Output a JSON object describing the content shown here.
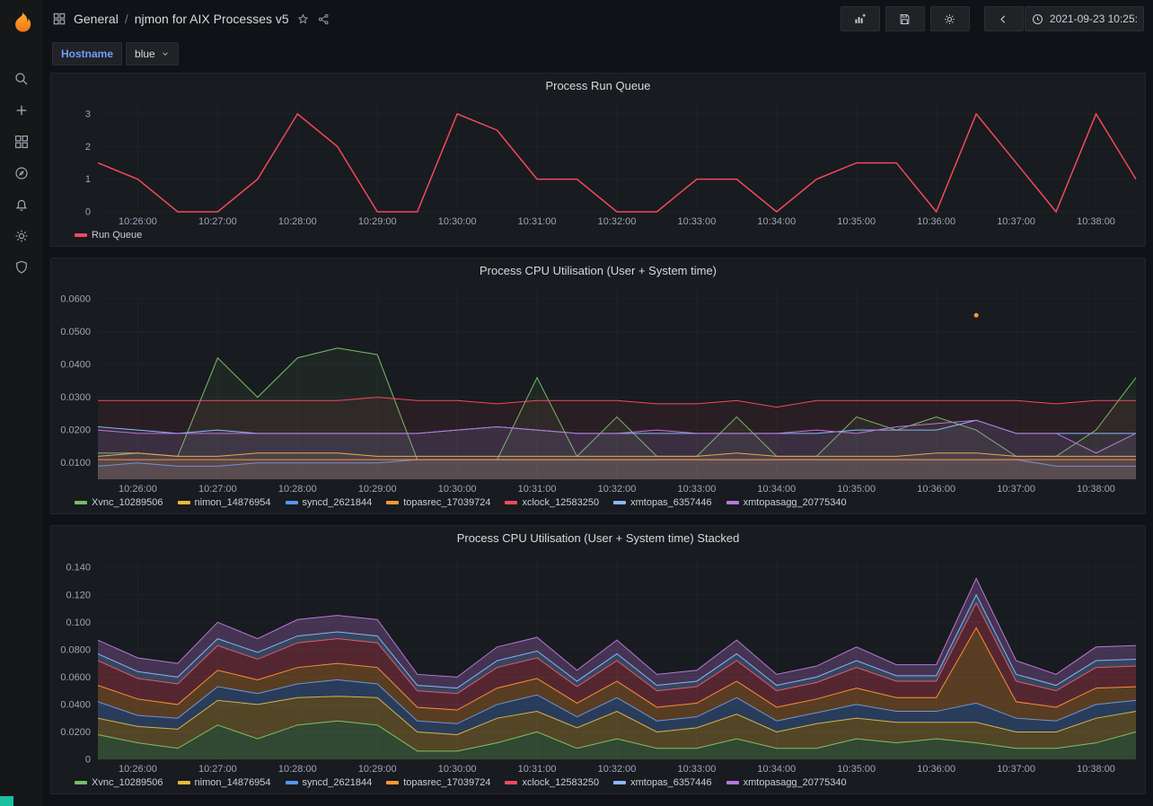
{
  "app": {
    "name": "Grafana"
  },
  "sidebar": {
    "items": [
      "search",
      "create",
      "dashboards",
      "explore",
      "alerting",
      "configuration",
      "server-admin"
    ]
  },
  "navbar": {
    "breadcrumb": {
      "section": "General",
      "separator": "/",
      "title": "njmon for AIX Processes v5"
    },
    "time_range": "2021-09-23 10:25:"
  },
  "variables": {
    "hostname_label": "Hostname",
    "hostname_value": "blue"
  },
  "colors": {
    "green": "#73BF69",
    "yellow": "#EAB839",
    "blue": "#5794F2",
    "orange": "#FF9830",
    "red": "#F2495C",
    "light_blue": "#8AB8FF",
    "purple": "#B877D9",
    "accent_blue": "#6e9fff"
  },
  "chart_data": [
    {
      "type": "line",
      "title": "Process Run Queue",
      "stacked": false,
      "fill_opacity": 0,
      "line_width": 1.5,
      "ylim": [
        0,
        3.3
      ],
      "y_ticks": {
        "values": [
          0,
          1,
          2,
          3
        ],
        "labels": [
          "0",
          "1",
          "2",
          "3"
        ]
      },
      "x": [
        "10:25:30",
        "10:26:00",
        "10:26:30",
        "10:27:00",
        "10:27:30",
        "10:28:00",
        "10:28:30",
        "10:29:00",
        "10:29:30",
        "10:30:00",
        "10:30:30",
        "10:31:00",
        "10:31:30",
        "10:32:00",
        "10:32:30",
        "10:33:00",
        "10:33:30",
        "10:34:00",
        "10:34:30",
        "10:35:00",
        "10:35:30",
        "10:36:00",
        "10:36:30",
        "10:37:00",
        "10:37:30",
        "10:38:00",
        "10:38:30"
      ],
      "x_ticks": [
        "10:26:00",
        "10:27:00",
        "10:28:00",
        "10:29:00",
        "10:30:00",
        "10:31:00",
        "10:32:00",
        "10:33:00",
        "10:34:00",
        "10:35:00",
        "10:36:00",
        "10:37:00",
        "10:38:00"
      ],
      "series": [
        {
          "name": "Run Queue",
          "color": "#F2495C",
          "values": [
            1.5,
            1,
            0,
            0,
            1,
            3,
            2,
            0,
            0,
            3,
            2.5,
            1,
            1,
            0,
            0,
            1,
            1,
            0,
            1,
            1.5,
            1.5,
            0,
            3,
            1.5,
            0,
            3,
            1
          ]
        }
      ]
    },
    {
      "type": "line",
      "title": "Process CPU Utilisation (User + System time)",
      "stacked": false,
      "fill_opacity": 0.08,
      "line_width": 1,
      "ylim": [
        0.005,
        0.063
      ],
      "y_ticks": {
        "values": [
          0.01,
          0.02,
          0.03,
          0.04,
          0.05,
          0.06
        ],
        "labels": [
          "0.0100",
          "0.0200",
          "0.0300",
          "0.0400",
          "0.0500",
          "0.0600"
        ]
      },
      "x": [
        "10:25:30",
        "10:26:00",
        "10:26:30",
        "10:27:00",
        "10:27:30",
        "10:28:00",
        "10:28:30",
        "10:29:00",
        "10:29:30",
        "10:30:00",
        "10:30:30",
        "10:31:00",
        "10:31:30",
        "10:32:00",
        "10:32:30",
        "10:33:00",
        "10:33:30",
        "10:34:00",
        "10:34:30",
        "10:35:00",
        "10:35:30",
        "10:36:00",
        "10:36:30",
        "10:37:00",
        "10:37:30",
        "10:38:00",
        "10:38:30"
      ],
      "x_ticks": [
        "10:26:00",
        "10:27:00",
        "10:28:00",
        "10:29:00",
        "10:30:00",
        "10:31:00",
        "10:32:00",
        "10:33:00",
        "10:34:00",
        "10:35:00",
        "10:36:00",
        "10:37:00",
        "10:38:00"
      ],
      "point_markers": [
        {
          "x": "10:36:30",
          "value": 0.055,
          "color": "#FF9830",
          "series": "topasrec_17039724"
        }
      ],
      "series": [
        {
          "name": "Xvnc_10289506",
          "color": "#73BF69",
          "values": [
            0.013,
            0.013,
            0.012,
            0.042,
            0.03,
            0.042,
            0.045,
            0.043,
            0.011,
            0.011,
            0.011,
            0.036,
            0.012,
            0.024,
            0.012,
            0.012,
            0.024,
            0.012,
            0.012,
            0.024,
            0.02,
            0.024,
            0.02,
            0.012,
            0.012,
            0.02,
            0.036
          ]
        },
        {
          "name": "nimon_14876954",
          "color": "#EAB839",
          "values": [
            0.012,
            0.013,
            0.012,
            0.012,
            0.013,
            0.013,
            0.013,
            0.012,
            0.012,
            0.012,
            0.012,
            0.012,
            0.012,
            0.012,
            0.012,
            0.012,
            0.013,
            0.012,
            0.012,
            0.012,
            0.012,
            0.013,
            0.013,
            0.012,
            0.012,
            0.012,
            0.012
          ]
        },
        {
          "name": "syncd_2621844",
          "color": "#5794F2",
          "values": [
            0.009,
            0.01,
            0.009,
            0.009,
            0.01,
            0.01,
            0.01,
            0.01,
            0.011,
            0.011,
            0.011,
            0.011,
            0.011,
            0.011,
            0.011,
            0.011,
            0.011,
            0.011,
            0.011,
            0.011,
            0.011,
            0.011,
            0.011,
            0.011,
            0.009,
            0.009,
            0.009
          ]
        },
        {
          "name": "topasrec_17039724",
          "color": "#FF9830",
          "values": [
            0.011,
            0.011,
            0.011,
            0.011,
            0.011,
            0.011,
            0.011,
            0.011,
            0.011,
            0.011,
            0.011,
            0.011,
            0.011,
            0.011,
            0.011,
            0.011,
            0.011,
            0.011,
            0.011,
            0.011,
            0.011,
            0.011,
            0.011,
            0.011,
            0.011,
            0.011,
            0.011
          ]
        },
        {
          "name": "xclock_12583250",
          "color": "#F2495C",
          "values": [
            0.029,
            0.029,
            0.029,
            0.029,
            0.029,
            0.029,
            0.029,
            0.03,
            0.029,
            0.029,
            0.028,
            0.029,
            0.029,
            0.029,
            0.028,
            0.028,
            0.029,
            0.027,
            0.029,
            0.029,
            0.029,
            0.029,
            0.029,
            0.029,
            0.028,
            0.029,
            0.029
          ]
        },
        {
          "name": "xmtopas_6357446",
          "color": "#8AB8FF",
          "values": [
            0.021,
            0.02,
            0.019,
            0.02,
            0.019,
            0.019,
            0.019,
            0.019,
            0.019,
            0.02,
            0.021,
            0.02,
            0.019,
            0.019,
            0.019,
            0.019,
            0.019,
            0.019,
            0.019,
            0.02,
            0.02,
            0.02,
            0.023,
            0.019,
            0.019,
            0.019,
            0.019
          ]
        },
        {
          "name": "xmtopasagg_20775340",
          "color": "#B877D9",
          "values": [
            0.02,
            0.019,
            0.019,
            0.019,
            0.019,
            0.019,
            0.019,
            0.019,
            0.019,
            0.02,
            0.021,
            0.02,
            0.019,
            0.019,
            0.02,
            0.019,
            0.019,
            0.019,
            0.02,
            0.019,
            0.021,
            0.022,
            0.023,
            0.019,
            0.019,
            0.013,
            0.019
          ]
        }
      ]
    },
    {
      "type": "area",
      "title": "Process CPU Utilisation (User + System time) Stacked",
      "stacked": true,
      "fill_opacity": 0.28,
      "line_width": 1,
      "ylim": [
        0,
        0.148
      ],
      "y_ticks": {
        "values": [
          0,
          0.02,
          0.04,
          0.06,
          0.08,
          0.1,
          0.12,
          0.14
        ],
        "labels": [
          "0",
          "0.0200",
          "0.0400",
          "0.0600",
          "0.0800",
          "0.100",
          "0.120",
          "0.140"
        ]
      },
      "x": [
        "10:25:30",
        "10:26:00",
        "10:26:30",
        "10:27:00",
        "10:27:30",
        "10:28:00",
        "10:28:30",
        "10:29:00",
        "10:29:30",
        "10:30:00",
        "10:30:30",
        "10:31:00",
        "10:31:30",
        "10:32:00",
        "10:32:30",
        "10:33:00",
        "10:33:30",
        "10:34:00",
        "10:34:30",
        "10:35:00",
        "10:35:30",
        "10:36:00",
        "10:36:30",
        "10:37:00",
        "10:37:30",
        "10:38:00",
        "10:38:30"
      ],
      "x_ticks": [
        "10:26:00",
        "10:27:00",
        "10:28:00",
        "10:29:00",
        "10:30:00",
        "10:31:00",
        "10:32:00",
        "10:33:00",
        "10:34:00",
        "10:35:00",
        "10:36:00",
        "10:37:00",
        "10:38:00"
      ],
      "series": [
        {
          "name": "Xvnc_10289506",
          "color": "#73BF69",
          "values": [
            0.018,
            0.012,
            0.008,
            0.025,
            0.015,
            0.025,
            0.028,
            0.025,
            0.006,
            0.006,
            0.012,
            0.02,
            0.008,
            0.015,
            0.008,
            0.008,
            0.015,
            0.008,
            0.008,
            0.015,
            0.012,
            0.015,
            0.012,
            0.008,
            0.008,
            0.012,
            0.02
          ]
        },
        {
          "name": "nimon_14876954",
          "color": "#EAB839",
          "values": [
            0.012,
            0.012,
            0.014,
            0.018,
            0.025,
            0.02,
            0.018,
            0.02,
            0.014,
            0.012,
            0.018,
            0.015,
            0.015,
            0.02,
            0.012,
            0.015,
            0.018,
            0.012,
            0.018,
            0.015,
            0.015,
            0.012,
            0.015,
            0.012,
            0.012,
            0.018,
            0.015
          ]
        },
        {
          "name": "syncd_2621844",
          "color": "#5794F2",
          "values": [
            0.012,
            0.008,
            0.008,
            0.01,
            0.008,
            0.01,
            0.012,
            0.01,
            0.008,
            0.008,
            0.01,
            0.012,
            0.008,
            0.01,
            0.008,
            0.008,
            0.012,
            0.008,
            0.008,
            0.01,
            0.008,
            0.008,
            0.014,
            0.01,
            0.008,
            0.01,
            0.008
          ]
        },
        {
          "name": "topasrec_17039724",
          "color": "#FF9830",
          "values": [
            0.012,
            0.012,
            0.01,
            0.012,
            0.01,
            0.012,
            0.012,
            0.012,
            0.01,
            0.01,
            0.012,
            0.012,
            0.01,
            0.012,
            0.01,
            0.01,
            0.012,
            0.01,
            0.01,
            0.012,
            0.01,
            0.01,
            0.055,
            0.012,
            0.01,
            0.012,
            0.01
          ]
        },
        {
          "name": "xclock_12583250",
          "color": "#F2495C",
          "values": [
            0.018,
            0.015,
            0.015,
            0.018,
            0.015,
            0.018,
            0.018,
            0.018,
            0.012,
            0.012,
            0.015,
            0.015,
            0.012,
            0.015,
            0.012,
            0.012,
            0.015,
            0.012,
            0.012,
            0.015,
            0.012,
            0.012,
            0.018,
            0.015,
            0.012,
            0.015,
            0.015
          ]
        },
        {
          "name": "xmtopas_6357446",
          "color": "#8AB8FF",
          "values": [
            0.005,
            0.005,
            0.005,
            0.005,
            0.005,
            0.005,
            0.005,
            0.005,
            0.004,
            0.004,
            0.005,
            0.005,
            0.004,
            0.005,
            0.004,
            0.004,
            0.005,
            0.004,
            0.004,
            0.005,
            0.004,
            0.004,
            0.006,
            0.005,
            0.004,
            0.005,
            0.005
          ]
        },
        {
          "name": "xmtopasagg_20775340",
          "color": "#B877D9",
          "values": [
            0.01,
            0.01,
            0.01,
            0.012,
            0.01,
            0.012,
            0.012,
            0.012,
            0.008,
            0.008,
            0.01,
            0.01,
            0.008,
            0.01,
            0.008,
            0.008,
            0.01,
            0.008,
            0.008,
            0.01,
            0.008,
            0.008,
            0.012,
            0.01,
            0.008,
            0.01,
            0.01
          ]
        }
      ]
    }
  ]
}
